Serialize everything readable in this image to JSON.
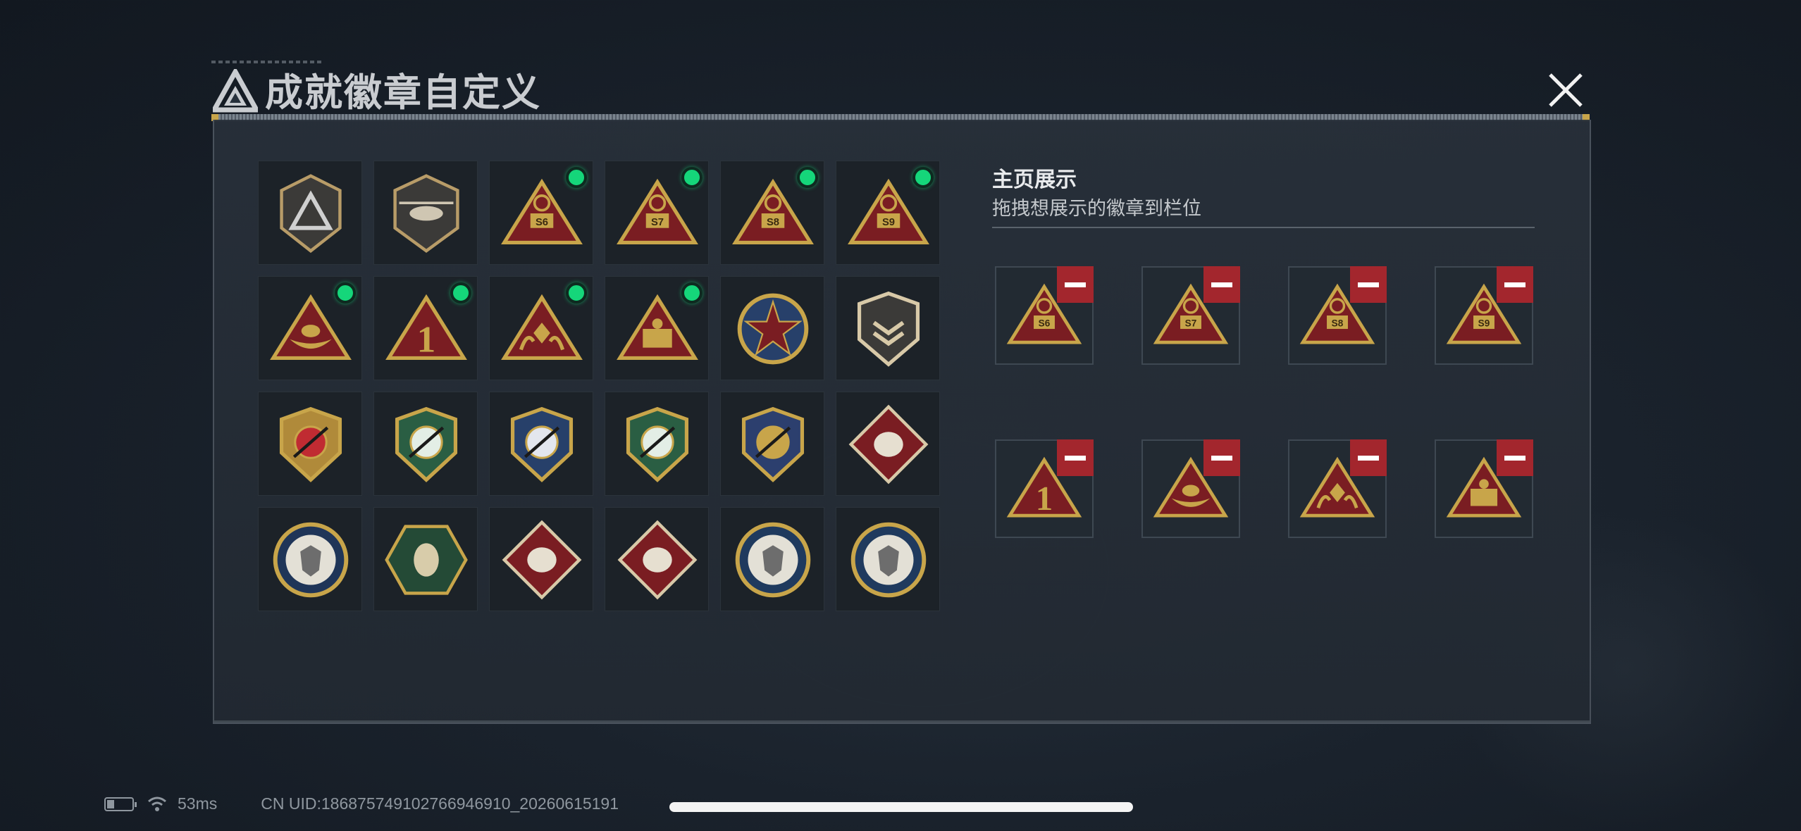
{
  "header": {
    "title": "成就徽章自定义",
    "logo_icon": "triangle-logo-icon",
    "close_icon": "close-icon"
  },
  "badges": [
    {
      "icon": "shield-triangle-badge-icon",
      "equipped": false
    },
    {
      "icon": "helicopter-badge-icon",
      "equipped": false
    },
    {
      "icon": "s6-triangle-badge-icon",
      "label": "S6",
      "equipped": true
    },
    {
      "icon": "s7-triangle-badge-icon",
      "label": "S7",
      "equipped": true
    },
    {
      "icon": "s8-triangle-badge-icon",
      "label": "S8",
      "equipped": true
    },
    {
      "icon": "s9-triangle-badge-icon",
      "label": "S9",
      "equipped": true
    },
    {
      "icon": "hand-triangle-badge-icon",
      "equipped": true
    },
    {
      "icon": "number-one-triangle-badge-icon",
      "label": "1",
      "equipped": true
    },
    {
      "icon": "diamond-hands-triangle-badge-icon",
      "equipped": true
    },
    {
      "icon": "soldiers-triangle-badge-icon",
      "equipped": true
    },
    {
      "icon": "star-emblem-badge-icon",
      "equipped": false
    },
    {
      "icon": "chevron-shield-badge-icon",
      "equipped": false
    },
    {
      "icon": "red-gold-wing-badge-icon",
      "equipped": false
    },
    {
      "icon": "green-crystal-shield-badge-icon",
      "equipped": false
    },
    {
      "icon": "blue-crosshair-rifle-badge-icon",
      "equipped": false
    },
    {
      "icon": "green-crosshair-rifle-badge-icon",
      "equipped": false
    },
    {
      "icon": "gold-crossed-blades-badge-icon",
      "equipped": false
    },
    {
      "icon": "wolf-diamond-badge-icon",
      "equipped": false
    },
    {
      "icon": "eagle-circle-badge-icon",
      "equipped": false
    },
    {
      "icon": "scorpion-hexagon-badge-icon",
      "equipped": false
    },
    {
      "icon": "dragon-diamond-badge-icon",
      "equipped": false
    },
    {
      "icon": "runner-diamond-badge-icon",
      "equipped": false
    },
    {
      "icon": "wolf-circle-badge-icon",
      "equipped": false
    },
    {
      "icon": "wolf-circle-badge-icon",
      "equipped": false
    }
  ],
  "display": {
    "title": "主页展示",
    "subtitle": "拖拽想展示的徽章到栏位",
    "slots": [
      {
        "icon": "s6-triangle-badge-icon",
        "label": "S6"
      },
      {
        "icon": "s7-triangle-badge-icon",
        "label": "S7"
      },
      {
        "icon": "s8-triangle-badge-icon",
        "label": "S8"
      },
      {
        "icon": "s9-triangle-badge-icon",
        "label": "S9"
      },
      {
        "icon": "number-one-triangle-badge-icon",
        "label": "1"
      },
      {
        "icon": "hand-triangle-badge-icon"
      },
      {
        "icon": "diamond-hands-triangle-badge-icon"
      },
      {
        "icon": "soldiers-triangle-badge-icon"
      }
    ]
  },
  "status_bar": {
    "ping": "53ms",
    "uid": "CN UID:18687574910276694691​0_20260615191"
  },
  "colors": {
    "equipped_dot": "#15d67a",
    "remove_button": "#a3262d",
    "gold": "#c8a54a",
    "badge_red": "#7a1d22"
  }
}
